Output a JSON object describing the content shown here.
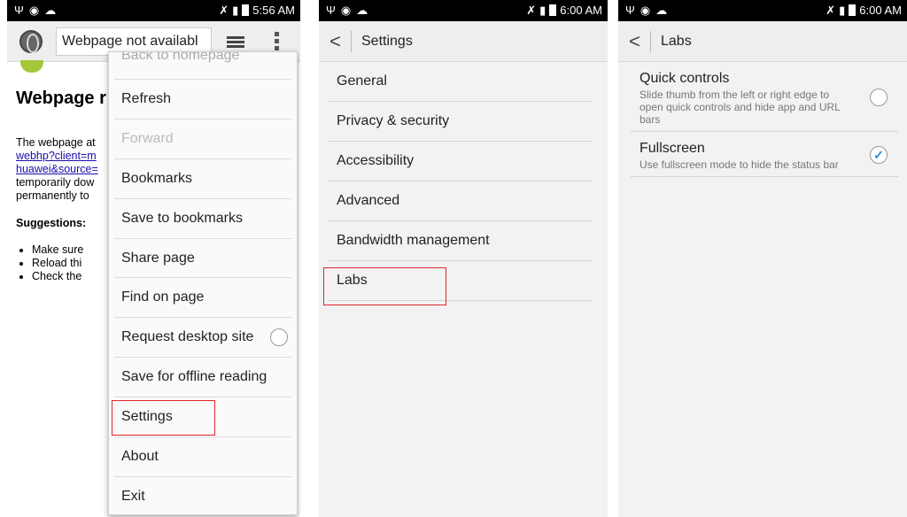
{
  "panel1": {
    "status": {
      "icons": [
        "usb-icon",
        "photo-icon",
        "sync-icon"
      ],
      "time": "5:56 AM"
    },
    "url": "Webpage not availabl",
    "page": {
      "title": "Webpage r",
      "para_lines": [
        "The webpage at",
        "webhp?client=m",
        "huawei&source=",
        "temporarily dow",
        "permanently to"
      ],
      "suggestions": "Suggestions:",
      "bullets": [
        "Make sure",
        "Reload thi",
        "Check the"
      ]
    },
    "menu": {
      "first": "Back to homepage",
      "items": [
        {
          "label": "Refresh",
          "disabled": false
        },
        {
          "label": "Forward",
          "disabled": true
        },
        {
          "label": "Bookmarks",
          "disabled": false
        },
        {
          "label": "Save to bookmarks",
          "disabled": false
        },
        {
          "label": "Share page",
          "disabled": false
        },
        {
          "label": "Find on page",
          "disabled": false
        },
        {
          "label": "Request desktop site",
          "disabled": false
        },
        {
          "label": "Save for offline reading",
          "disabled": false
        },
        {
          "label": "Settings",
          "disabled": false
        },
        {
          "label": "About",
          "disabled": false
        },
        {
          "label": "Exit",
          "disabled": false
        }
      ]
    }
  },
  "panel2": {
    "status": {
      "time": "6:00 AM"
    },
    "title": "Settings",
    "items": [
      "General",
      "Privacy & security",
      "Accessibility",
      "Advanced",
      "Bandwidth management",
      "Labs"
    ]
  },
  "panel3": {
    "status": {
      "time": "6:00 AM"
    },
    "title": "Labs",
    "options": [
      {
        "title": "Quick controls",
        "desc": "Slide thumb from the left or right edge to open quick controls and hide app and URL bars",
        "checked": false
      },
      {
        "title": "Fullscreen",
        "desc": "Use fullscreen mode to hide the status bar",
        "checked": true
      }
    ]
  },
  "colors": {
    "highlight": "#e0242b",
    "check": "#2b8ad8"
  }
}
